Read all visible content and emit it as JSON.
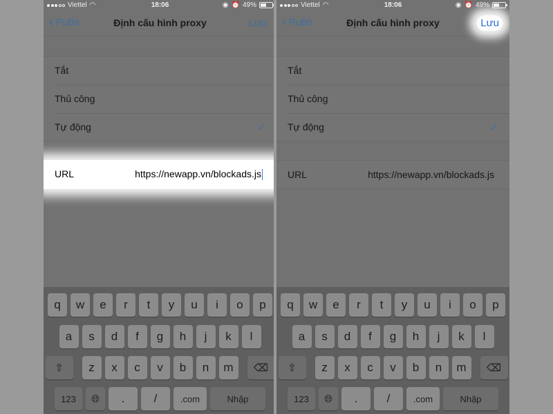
{
  "status": {
    "carrier": "Viettel",
    "time": "18:06",
    "battery": "49%"
  },
  "nav": {
    "back": "Putin",
    "title": "Định cấu hình proxy",
    "save": "Lưu"
  },
  "options": [
    {
      "label": "Tắt",
      "checked": false
    },
    {
      "label": "Thủ công",
      "checked": false
    },
    {
      "label": "Tự động",
      "checked": true
    }
  ],
  "check_mark": "✓",
  "url_row": {
    "label": "URL",
    "value": "https://newapp.vn/blockads.js"
  },
  "keyboard": {
    "row1": [
      "q",
      "w",
      "e",
      "r",
      "t",
      "y",
      "u",
      "i",
      "o",
      "p"
    ],
    "row2": [
      "a",
      "s",
      "d",
      "f",
      "g",
      "h",
      "j",
      "k",
      "l"
    ],
    "row3": [
      "z",
      "x",
      "c",
      "v",
      "b",
      "n",
      "m"
    ],
    "k123": "123",
    "dot": ".",
    "slash": "/",
    "com": ".com",
    "enter": "Nhập"
  },
  "icons": {
    "signal": "signal-icon",
    "wifi": "wifi-icon",
    "lock": "orientation-lock-icon",
    "alarm": "alarm-icon",
    "battery": "battery-icon",
    "back": "chevron-left-icon",
    "check": "check-icon",
    "shift": "shift-icon",
    "delete": "delete-icon",
    "globe": "globe-icon"
  },
  "highlight_color": "#ffffff",
  "accent_color": "#3f6e9e"
}
